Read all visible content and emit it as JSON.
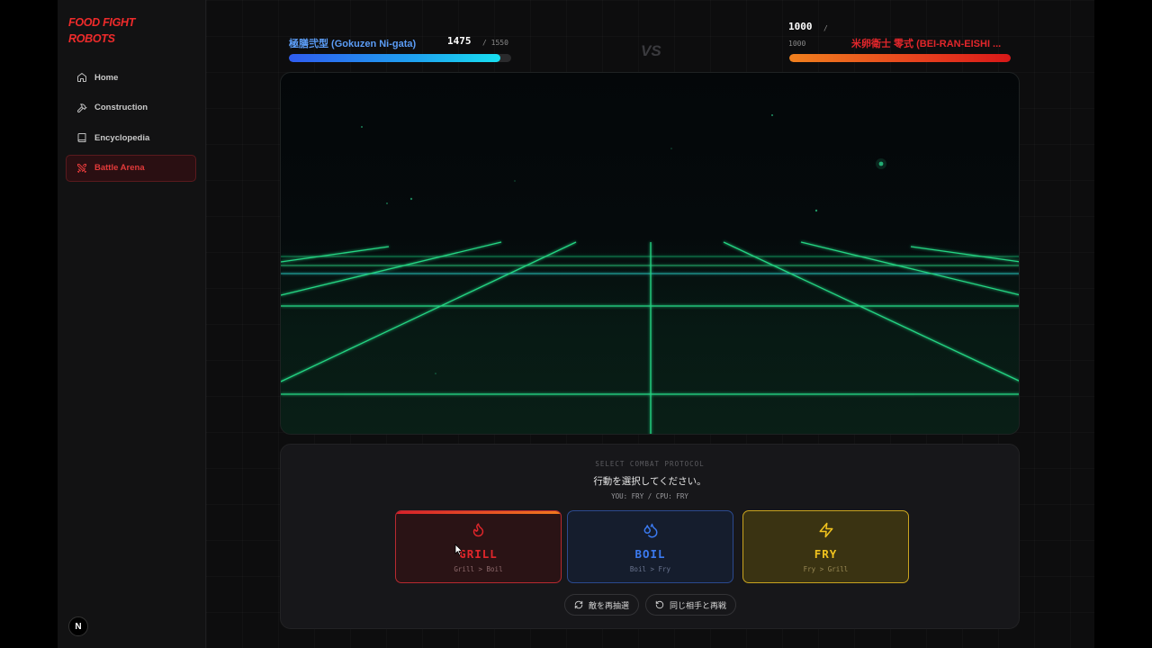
{
  "app": {
    "logo_line1": "FOOD FIGHT",
    "logo_line2": "ROBOTS",
    "n_badge": "N"
  },
  "sidebar": {
    "items": [
      {
        "label": "Home",
        "icon": "home-icon",
        "active": false
      },
      {
        "label": "Construction",
        "icon": "hammer-icon",
        "active": false
      },
      {
        "label": "Encyclopedia",
        "icon": "book-icon",
        "active": false
      },
      {
        "label": "Battle Arena",
        "icon": "swords-icon",
        "active": true
      }
    ]
  },
  "battle": {
    "player": {
      "name": "極膳弐型 (Gokuzen Ni-gata)",
      "hp": "1475",
      "hp_max": "/ 1550",
      "hp_fraction": 0.952,
      "color": "#5b9cf5"
    },
    "vs_label": "VS",
    "enemy": {
      "name": "米卵衛士 零式 (BEI-RAN-EISHI ...",
      "hp": "1000",
      "hp_sep": "/",
      "hp_max": "1000",
      "hp_fraction": 1.0,
      "color": "#e2262b"
    }
  },
  "panel": {
    "protocol_label": "SELECT COMBAT PROTOCOL",
    "prompt": "行動を選択してください。",
    "status": "YOU: FRY / CPU: FRY",
    "actions": [
      {
        "title": "GRILL",
        "sub": "Grill > Boil",
        "icon": "flame-icon",
        "color": "#e2262b"
      },
      {
        "title": "BOIL",
        "sub": "Boil > Fry",
        "icon": "droplets-icon",
        "color": "#3b7af0"
      },
      {
        "title": "FRY",
        "sub": "Fry > Grill",
        "icon": "zap-icon",
        "color": "#f0c21e"
      }
    ],
    "reroll_label": "敵を再抽選",
    "rematch_label": "同じ相手と再戦"
  }
}
